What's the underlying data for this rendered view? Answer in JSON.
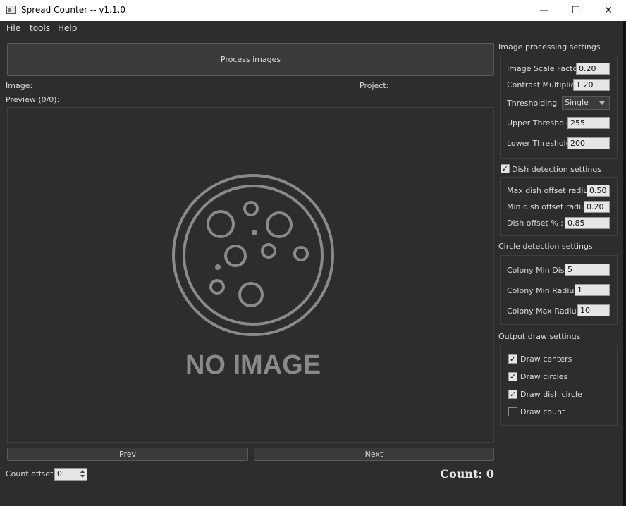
{
  "window": {
    "title": "Spread Counter -- v1.1.0",
    "minimize": "—",
    "maximize": "☐",
    "close": "✕"
  },
  "menu": [
    "File",
    "tools",
    "Help"
  ],
  "main": {
    "process_button": "Process images",
    "image_label": "Image:",
    "project_label": "Project:",
    "preview_label": "Preview (0/0):",
    "no_image_text": "NO IMAGE",
    "prev_button": "Prev",
    "next_button": "Next",
    "count_offset_label": "Count offset",
    "count_offset_value": "0",
    "count_text": "Count: 0"
  },
  "image_processing": {
    "title": "Image processing settings",
    "scale_label": "Image Scale Factor",
    "scale_value": "0.20",
    "contrast_label": "Contrast Multiplier",
    "contrast_value": "1.20",
    "threshold_label": "Thresholding",
    "threshold_value": "Single",
    "upper_label": "Upper Threshold",
    "upper_value": "255",
    "lower_label": "Lower Threshold",
    "lower_value": "200"
  },
  "dish_detection": {
    "title": "Dish detection settings",
    "enabled": true,
    "max_label": "Max dish offset radius",
    "max_value": "0.50",
    "min_label": "Min dish offset radius",
    "min_value": "0.20",
    "pct_label": "Dish offset % :",
    "pct_value": "0.85"
  },
  "circle_detection": {
    "title": "Circle detection settings",
    "mindist_label": "Colony Min Dist",
    "mindist_value": "5",
    "minrad_label": "Colony Min Radius",
    "minrad_value": "1",
    "maxrad_label": "Colony Max Radius",
    "maxrad_value": "10"
  },
  "output_draw": {
    "title": "Output draw settings",
    "items": [
      {
        "label": "Draw centers",
        "checked": true
      },
      {
        "label": "Draw circles",
        "checked": true
      },
      {
        "label": "Draw dish circle",
        "checked": true
      },
      {
        "label": "Draw count",
        "checked": false
      }
    ]
  },
  "colors": {
    "background": "#2d2d2d",
    "placeholder": "#8a8a8a"
  }
}
